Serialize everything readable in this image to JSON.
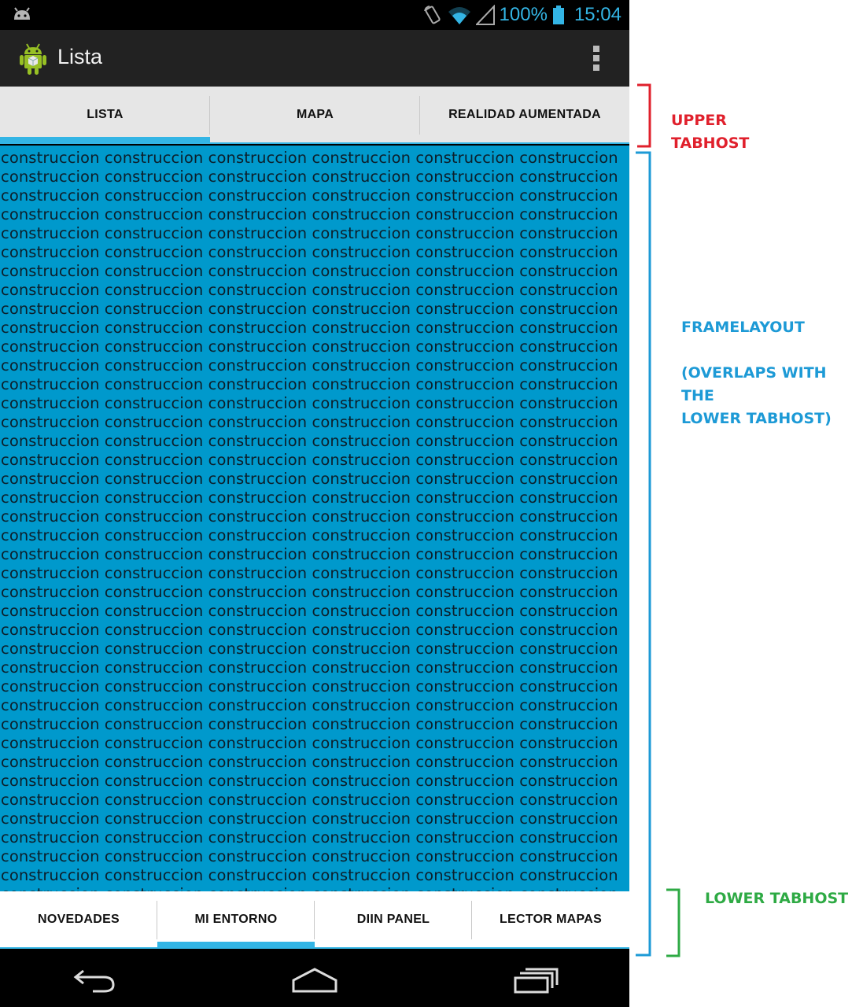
{
  "status_bar": {
    "battery_percent": "100%",
    "time": "15:04",
    "icons": [
      "android-debug-icon",
      "rotation-lock-icon",
      "wifi-icon",
      "signal-icon",
      "battery-icon"
    ]
  },
  "action_bar": {
    "title": "Lista",
    "app_icon": "android-icon",
    "menu_icon": "overflow-menu-icon"
  },
  "upper_tabs": [
    {
      "label": "LISTA",
      "selected": true
    },
    {
      "label": "MAPA",
      "selected": false
    },
    {
      "label": "REALIDAD AUMENTADA",
      "selected": false
    }
  ],
  "frame_layout": {
    "word": "construccion",
    "text": "construccion construccion construccion construccion construccion construccion\nconstruccion construccion construccion construccion construccion construccion\nconstruccion construccion construccion construccion construccion construccion\nconstruccion construccion construccion construccion construccion construccion\nconstruccion construccion construccion construccion construccion construccion\nconstruccion construccion construccion construccion construccion construccion\nconstruccion construccion construccion construccion construccion construccion\nconstruccion construccion construccion construccion construccion construccion\nconstruccion construccion construccion construccion construccion construccion\nconstruccion construccion construccion construccion construccion construccion\nconstruccion construccion construccion construccion construccion construccion\nconstruccion construccion construccion construccion construccion construccion\nconstruccion construccion construccion construccion construccion construccion\nconstruccion construccion construccion construccion construccion construccion\nconstruccion construccion construccion construccion construccion construccion\nconstruccion construccion construccion construccion construccion construccion\nconstruccion construccion construccion construccion construccion construccion\nconstruccion construccion construccion construccion construccion construccion\nconstruccion construccion construccion construccion construccion construccion\nconstruccion construccion construccion construccion construccion construccion\nconstruccion construccion construccion construccion construccion construccion\nconstruccion construccion construccion construccion construccion construccion\nconstruccion construccion   construccion construccion construccion construccion\nconstruccion construccion construccion construccion construccion construccion\nconstruccion construccion construccion construccion construccion construccion\nconstruccion construccion construccion construccion construccion construccion\nconstruccion construccion construccion construccion construccion construccion\nconstruccion construccion construccion construccion construccion construccion\nconstruccion construccion construccion construccion construccion construccion\nconstruccion construccion construccion construccion construccion construccion\nconstruccion construccion construccion construccion construccion construccion\nconstruccion construccion construccion construccion construccion construccion\nconstruccion construccion construccion construccion construccion construccion\nconstruccion construccion construccion construccion construccion construccion\nconstruccion construccion construccion construccion construccion construccion\nconstruccion construccion construccion construccion construccion construccion\nconstruccion construccion construccion construccion construccion construccion\nconstruccion construccion construccion construccion construccion construccion\nconstruccion construccion construccion construccion construccion construccion\nconstruccion construccion construccion construccion construccion construccion\nconstruccion construccion construccion construccion construccion construccion",
    "background_color": "#0099cc"
  },
  "lower_tabs": [
    {
      "label": "NOVEDADES",
      "selected": false
    },
    {
      "label": "MI ENTORNO",
      "selected": true
    },
    {
      "label": "DIIN PANEL",
      "selected": false
    },
    {
      "label": "LECTOR MAPAS",
      "selected": false
    }
  ],
  "nav_bar": {
    "icons": [
      "back-icon",
      "home-icon",
      "recent-apps-icon"
    ]
  },
  "annotations": {
    "upper_tabhost": "UPPER\nTABHOST",
    "framelayout": "FRAMELAYOUT\n\n(OVERLAPS WITH THE\nLOWER TABHOST)",
    "lower_tabhost": "LOWER TABHOST",
    "colors": {
      "upper": "#e0202c",
      "frame": "#1d9ad6",
      "lower": "#2eaa44"
    }
  },
  "accent_color": "#33b5e5"
}
